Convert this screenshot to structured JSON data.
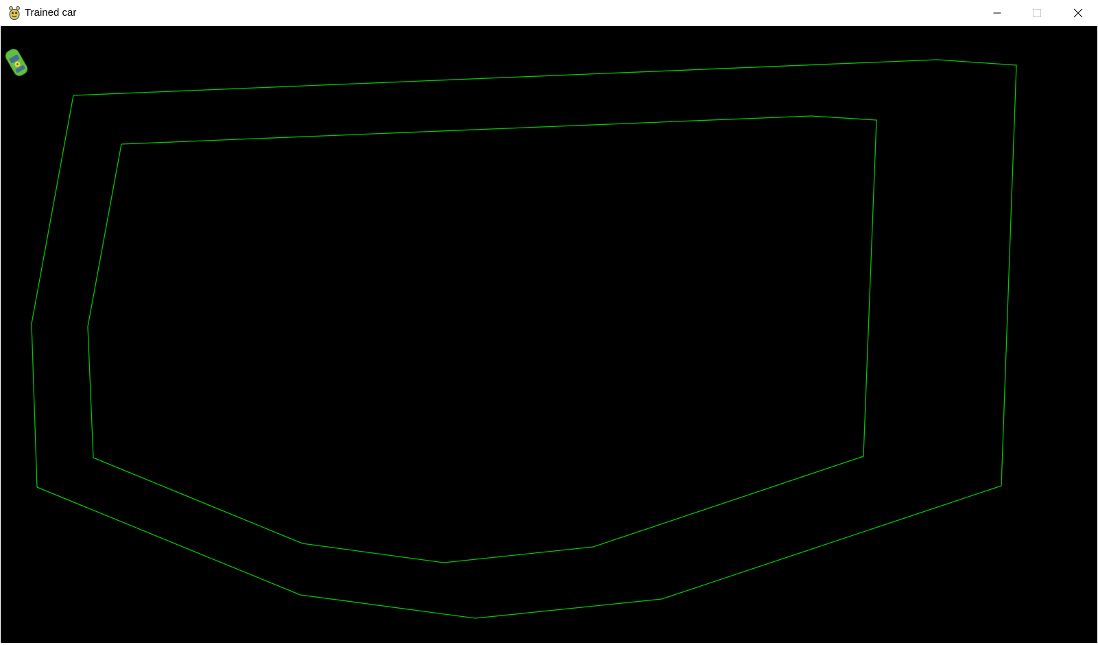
{
  "window": {
    "title": "Trained car",
    "app_icon": "pygame-snake-icon",
    "controls": {
      "minimize_icon": "minimize-icon",
      "maximize_icon": "maximize-icon",
      "close_icon": "close-icon"
    }
  },
  "game": {
    "background_color": "#000000",
    "track_color": "#00c800",
    "car_color": "#5fc23c",
    "car_icon": "car-sprite"
  }
}
